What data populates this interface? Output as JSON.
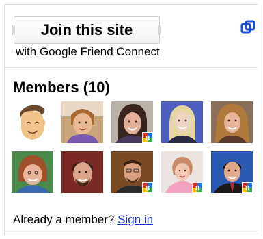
{
  "join": {
    "button_label": "Join this site",
    "caption": "with Google Friend Connect"
  },
  "members": {
    "title": "Members (10)",
    "avatars": [
      {
        "name": "cartoon-face",
        "badge": false
      },
      {
        "name": "member-2",
        "badge": false
      },
      {
        "name": "member-3",
        "badge": true
      },
      {
        "name": "member-4",
        "badge": false
      },
      {
        "name": "member-5",
        "badge": false
      },
      {
        "name": "member-6",
        "badge": false
      },
      {
        "name": "member-7",
        "badge": false
      },
      {
        "name": "member-8",
        "badge": true
      },
      {
        "name": "member-9",
        "badge": true
      },
      {
        "name": "member-10",
        "badge": true
      }
    ]
  },
  "footer": {
    "prompt": "Already a member? ",
    "signin_label": "Sign in"
  },
  "colors": {
    "link": "#1a35c9",
    "gfc_blue": "#1e4fd8"
  },
  "icons": {
    "corner": "google-friend-connect-icon",
    "badge": "google-badge-icon"
  }
}
